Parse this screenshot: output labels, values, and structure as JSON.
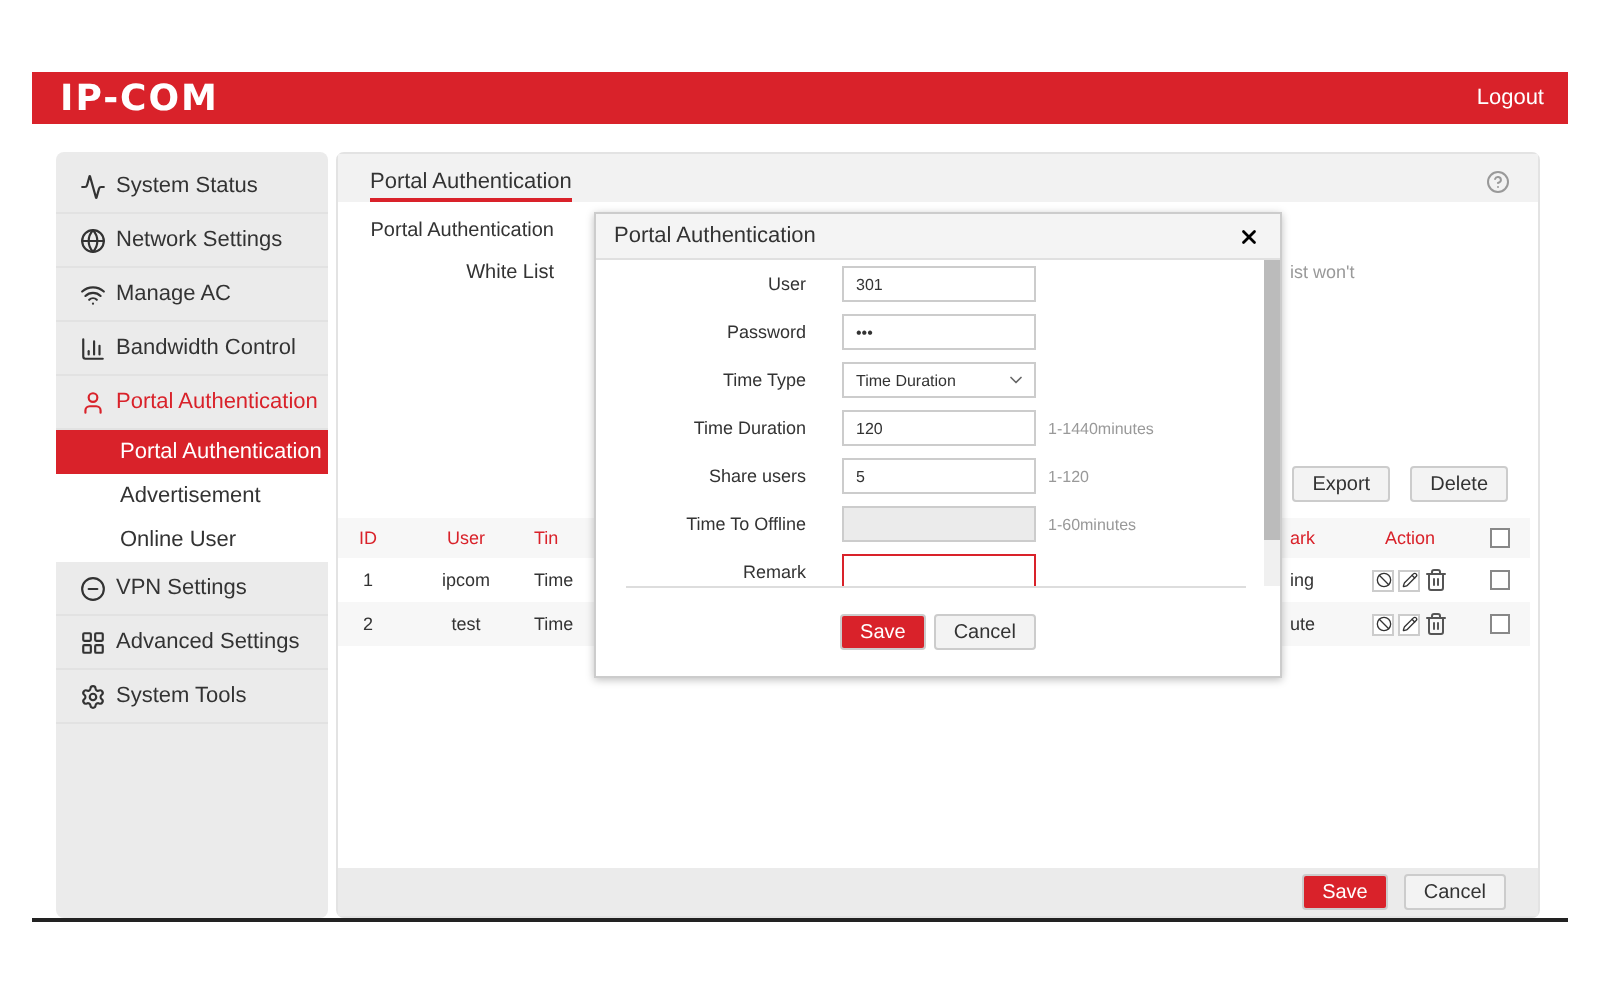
{
  "header": {
    "logo": "IP-COM",
    "logout": "Logout"
  },
  "sidebar": {
    "items": [
      {
        "label": "System Status",
        "selected": false
      },
      {
        "label": "Network Settings",
        "selected": false
      },
      {
        "label": "Manage AC",
        "selected": false
      },
      {
        "label": "Bandwidth Control",
        "selected": false
      },
      {
        "label": "Portal Authentication",
        "selected": true,
        "expanded": true,
        "children": [
          {
            "label": "Portal Authentication",
            "selected": true
          },
          {
            "label": "Advertisement",
            "selected": false
          },
          {
            "label": "Online User",
            "selected": false
          }
        ]
      },
      {
        "label": "VPN Settings",
        "selected": false
      },
      {
        "label": "Advanced Settings",
        "selected": false
      },
      {
        "label": "System Tools",
        "selected": false
      }
    ]
  },
  "content": {
    "tab": "Portal Authentication",
    "form_labels": [
      "Portal Authentication",
      "White List"
    ],
    "note": "ist won't",
    "buttons": [
      "Export",
      "Delete"
    ],
    "table": {
      "columns": [
        "ID",
        "User",
        "Tin",
        "ark",
        "Action"
      ],
      "select_all_checked": false,
      "rows": [
        {
          "cells": [
            "1",
            "ipcom",
            "Time",
            "ing"
          ],
          "checked": false
        },
        {
          "cells": [
            "2",
            "test",
            "Time",
            "ute"
          ],
          "checked": false
        }
      ]
    },
    "footer_buttons": [
      {
        "label": "Save",
        "primary": true
      },
      {
        "label": "Cancel",
        "primary": false
      }
    ]
  },
  "dialog": {
    "title": "Portal Authentication",
    "fields": [
      {
        "label": "User",
        "kind": "text",
        "value": "301",
        "disabled": false,
        "invalid": false
      },
      {
        "label": "Password",
        "kind": "text",
        "value": "•••",
        "disabled": false,
        "invalid": false
      },
      {
        "label": "Time Type",
        "kind": "select",
        "value": "Time Duration",
        "disabled": false,
        "invalid": false
      },
      {
        "label": "Time Duration",
        "kind": "text",
        "value": "120",
        "hint": "1-1440minutes",
        "disabled": false,
        "invalid": false
      },
      {
        "label": "Share users",
        "kind": "text",
        "value": "5",
        "hint": "1-120",
        "disabled": false,
        "invalid": false
      },
      {
        "label": "Time To Offline",
        "kind": "text",
        "hint": "1-60minutes",
        "disabled": true,
        "invalid": false
      },
      {
        "label": "Remark",
        "kind": "text",
        "disabled": false,
        "invalid": true
      }
    ],
    "buttons": [
      {
        "label": "Save",
        "primary": true
      },
      {
        "label": "Cancel",
        "primary": false
      }
    ]
  }
}
